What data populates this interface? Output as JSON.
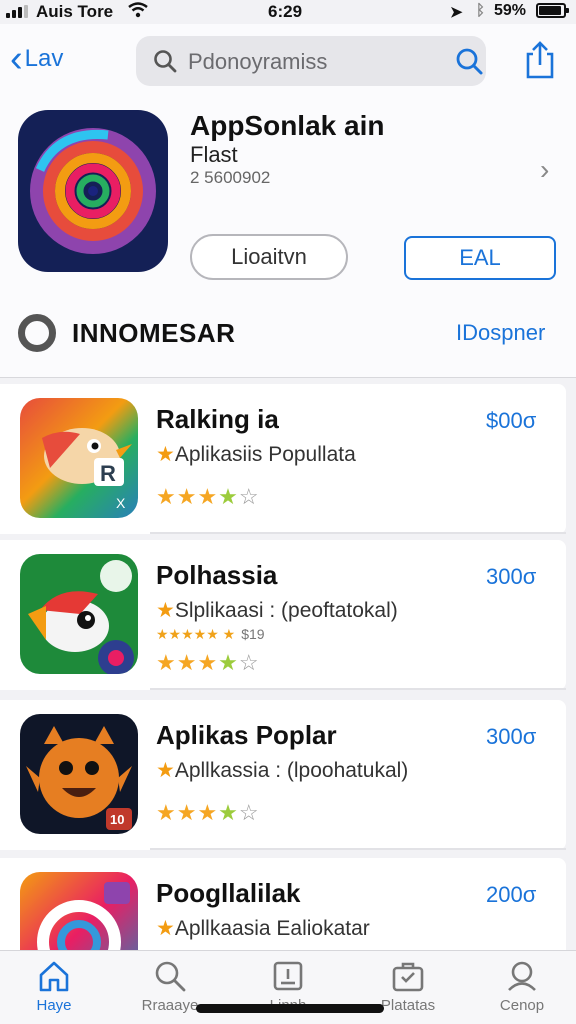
{
  "status_bar": {
    "carrier": "Auis Tore",
    "time": "6:29",
    "battery_pct": "59%"
  },
  "nav": {
    "back_label": "Lav",
    "search_text": "Pdonoyramiss"
  },
  "app": {
    "title": "AppSonlak ain",
    "subtitle": "Flast",
    "number": "2 5600902",
    "primary_button": "Lioaitvn",
    "secondary_button": "EAL"
  },
  "section": {
    "title": "INNOMESAR",
    "link": "IDospner"
  },
  "items": [
    {
      "name": "Ralking ia",
      "category": "Aplikasiis Popullata",
      "price": "$00σ",
      "rating": 3.5,
      "mini_rating": ""
    },
    {
      "name": "Polhassia",
      "category": "Slplikaasi : (peoftatokal)",
      "price": "300σ",
      "rating": 3.5,
      "mini_rating": "$19"
    },
    {
      "name": "Aplikas Poplar",
      "category": "Apllkassia : (lpoohatukal)",
      "price": "300σ",
      "rating": 3.5,
      "mini_rating": ""
    },
    {
      "name": "Poogllalilak",
      "category": "Apllkaasia Ealiokatar",
      "price": "200σ",
      "rating": 0,
      "mini_rating": ""
    }
  ],
  "tabs": [
    {
      "label": "Haye",
      "icon": "home-icon",
      "active": true
    },
    {
      "label": "Rraaaye",
      "icon": "search-icon",
      "active": false
    },
    {
      "label": "Linnh",
      "icon": "document-icon",
      "active": false
    },
    {
      "label": "Platatas",
      "icon": "briefcase-icon",
      "active": false
    },
    {
      "label": "Cenop",
      "icon": "profile-icon",
      "active": false
    }
  ],
  "colors": {
    "accent": "#1a73d9",
    "star": "#f5a623"
  }
}
